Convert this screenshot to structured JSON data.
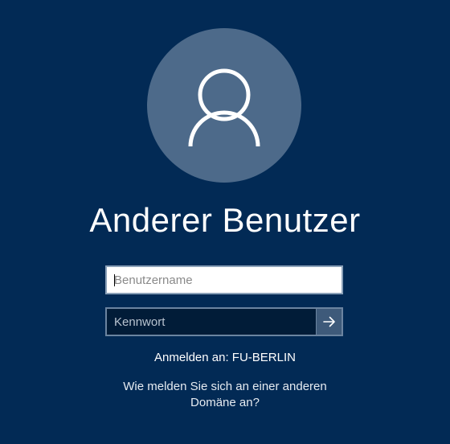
{
  "avatar": {
    "icon": "user-icon"
  },
  "title": "Anderer Benutzer",
  "username_field": {
    "value": "",
    "placeholder": "Benutzername"
  },
  "password_field": {
    "value": "",
    "placeholder": "Kennwort"
  },
  "submit_button": {
    "icon": "arrow-right-icon"
  },
  "domain_label": "Anmelden an: FU-BERLIN",
  "other_domain_link": "Wie melden Sie sich an einer anderen Domäne an?",
  "colors": {
    "background": "#022a55",
    "avatar_circle": "#4d6a8a",
    "password_field_bg": "#011c38",
    "submit_button_bg": "#3e5a7a",
    "field_border": "#8aa0b8"
  }
}
